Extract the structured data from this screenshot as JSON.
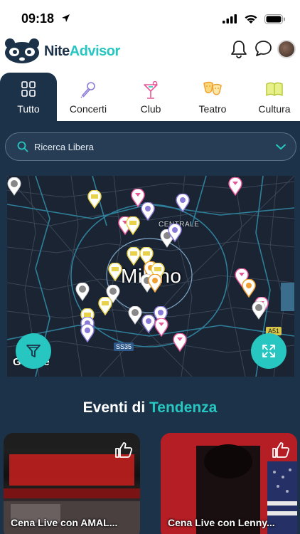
{
  "status_bar": {
    "time": "09:18"
  },
  "header": {
    "brand_part1": "Nite",
    "brand_part2": "Advisor"
  },
  "tabs": [
    {
      "label": "Tutto",
      "icon": "grid-icon",
      "active": true
    },
    {
      "label": "Concerti",
      "icon": "microphone-icon",
      "active": false
    },
    {
      "label": "Club",
      "icon": "cocktail-icon",
      "active": false
    },
    {
      "label": "Teatro",
      "icon": "theater-masks-icon",
      "active": false
    },
    {
      "label": "Cultura",
      "icon": "book-icon",
      "active": false
    }
  ],
  "search": {
    "placeholder": "Ricerca Libera"
  },
  "map": {
    "city_label": "Milano",
    "district_label": "CENTRALE",
    "road_shield_1": "SS35",
    "road_shield_2": "A51",
    "attribution": "Google"
  },
  "colors": {
    "accent": "#27c6c0",
    "navy": "#1c3249",
    "club_pink": "#e8569a",
    "concert_purple": "#8a7ad8",
    "culture_yellow": "#e8d24a",
    "teatro_orange": "#f0a030"
  },
  "trending": {
    "title_part1": "Eventi di",
    "title_part2": "Tendenza"
  },
  "events": [
    {
      "title": "Cena Live con AMAL..."
    },
    {
      "title": "Cena Live con Lenny..."
    }
  ]
}
